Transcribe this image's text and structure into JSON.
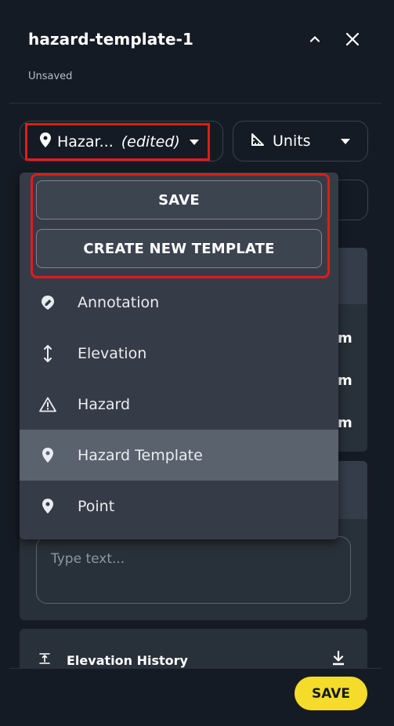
{
  "header": {
    "title": "hazard-template-1",
    "status": "Unsaved"
  },
  "selector": {
    "type_label": "Hazar...",
    "edited_label": "(edited)",
    "units_label": "Units"
  },
  "dropdown": {
    "save_label": "SAVE",
    "create_label": "CREATE NEW TEMPLATE",
    "items": [
      {
        "label": "Annotation",
        "icon": "annotation-icon"
      },
      {
        "label": "Elevation",
        "icon": "elevation-icon"
      },
      {
        "label": "Hazard",
        "icon": "hazard-icon"
      },
      {
        "label": "Hazard Template",
        "icon": "location-pin-icon",
        "selected": true
      },
      {
        "label": "Point",
        "icon": "location-pin-icon"
      }
    ]
  },
  "background": {
    "unit_suffix": "m",
    "textarea_placeholder": "Type text..."
  },
  "footer": {
    "section_label": "Elevation History",
    "save_label": "SAVE"
  },
  "colors": {
    "background": "#151b24",
    "menu": "#353c47",
    "highlight": "#e01b1b",
    "save_accent": "#f5dc2a"
  }
}
